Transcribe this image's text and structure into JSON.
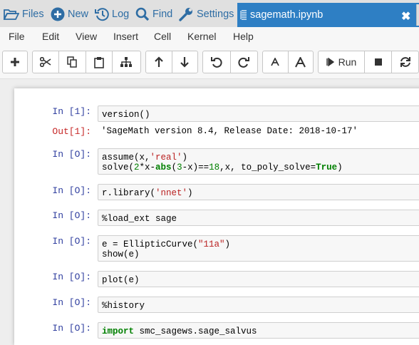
{
  "nav": {
    "files": "Files",
    "new": "New",
    "log": "Log",
    "find": "Find",
    "settings": "Settings",
    "tab_title": "sagemath.ipynb",
    "tab_close": "✖"
  },
  "menu": [
    "File",
    "Edit",
    "View",
    "Insert",
    "Cell",
    "Kernel",
    "Help"
  ],
  "toolbar": {
    "run_label": "Run"
  },
  "cells": [
    {
      "in_prompt": "In [1]:",
      "code": "version()",
      "out_prompt": "Out[1]:",
      "output": "'SageMath version 8.4, Release Date: 2018-10-17'"
    },
    {
      "in_prompt": "In [O]:",
      "line1": [
        "assume(x,",
        "'real'",
        ")"
      ],
      "line2": [
        "solve(",
        "2",
        "*x-",
        "abs",
        "(",
        "3",
        "-x)==",
        "18",
        ",x, to_poly_solve=",
        "True",
        ")"
      ]
    },
    {
      "in_prompt": "In [O]:",
      "parts": [
        "r.library(",
        "'nnet'",
        ")"
      ]
    },
    {
      "in_prompt": "In [O]:",
      "code": "%load_ext sage"
    },
    {
      "in_prompt": "In [O]:",
      "line1": [
        "e = EllipticCurve(",
        "\"11a\"",
        ")"
      ],
      "line2": "show(e)"
    },
    {
      "in_prompt": "In [O]:",
      "code": "plot(e)"
    },
    {
      "in_prompt": "In [O]:",
      "code": "%history"
    },
    {
      "in_prompt": "In [O]:",
      "parts": [
        "import",
        " smc_sagews.sage_salvus"
      ]
    }
  ]
}
